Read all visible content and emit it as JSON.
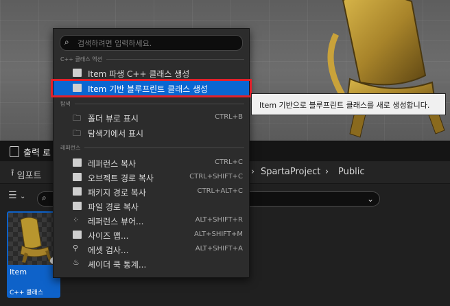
{
  "viewport": {
    "floor_color": "#666666",
    "chair_color": "#b8962e"
  },
  "output_log": {
    "tab_label": "출력 로"
  },
  "content_browser": {
    "import_label": "임포트",
    "breadcrumbs": [
      "SpartaProject",
      "Public"
    ],
    "asset": {
      "name": "Item",
      "type": "C++ 클래스"
    },
    "accent": "#0e62c9"
  },
  "menu": {
    "search_placeholder": "검색하려면 입력하세요.",
    "sections": {
      "cpp_actions": "C++ 클래스 액션",
      "explore": "탐색",
      "references": "레퍼런스"
    },
    "cpp_items": [
      {
        "label": "Item 파생 C++ 클래스 생성",
        "shortcut": "",
        "icon": "cpp-class-icon"
      },
      {
        "label": "Item 기반 블루프린트 클래스 생성",
        "shortcut": "",
        "icon": "cpp-class-icon",
        "selected": true
      }
    ],
    "explore_items": [
      {
        "label": "폴더 뷰로 표시",
        "shortcut": "CTRL+B",
        "icon": "folder-search-icon"
      },
      {
        "label": "탐색기에서 표시",
        "shortcut": "",
        "icon": "folder-search-icon"
      }
    ],
    "reference_items": [
      {
        "label": "레퍼런스 복사",
        "shortcut": "CTRL+C",
        "icon": "copy-icon"
      },
      {
        "label": "오브젝트 경로 복사",
        "shortcut": "CTRL+SHIFT+C",
        "icon": "copy-icon"
      },
      {
        "label": "패키지 경로 복사",
        "shortcut": "CTRL+ALT+C",
        "icon": "copy-icon"
      },
      {
        "label": "파일 경로 복사",
        "shortcut": "",
        "icon": "copy-icon"
      },
      {
        "label": "레퍼런스 뷰어...",
        "shortcut": "ALT+SHIFT+R",
        "icon": "reference-viewer-icon"
      },
      {
        "label": "사이즈 맵...",
        "shortcut": "ALT+SHIFT+M",
        "icon": "size-map-icon"
      },
      {
        "label": "에셋 검사...",
        "shortcut": "ALT+SHIFT+A",
        "icon": "audit-icon"
      },
      {
        "label": "셰이더 쿡 통계...",
        "shortcut": "",
        "icon": "shader-icon"
      }
    ],
    "selected_color": "#0a66d1",
    "highlight_color": "#e3202a"
  },
  "tooltip": {
    "text": "Item 기반으로 블루프린트 클래스를 새로 생성합니다."
  }
}
